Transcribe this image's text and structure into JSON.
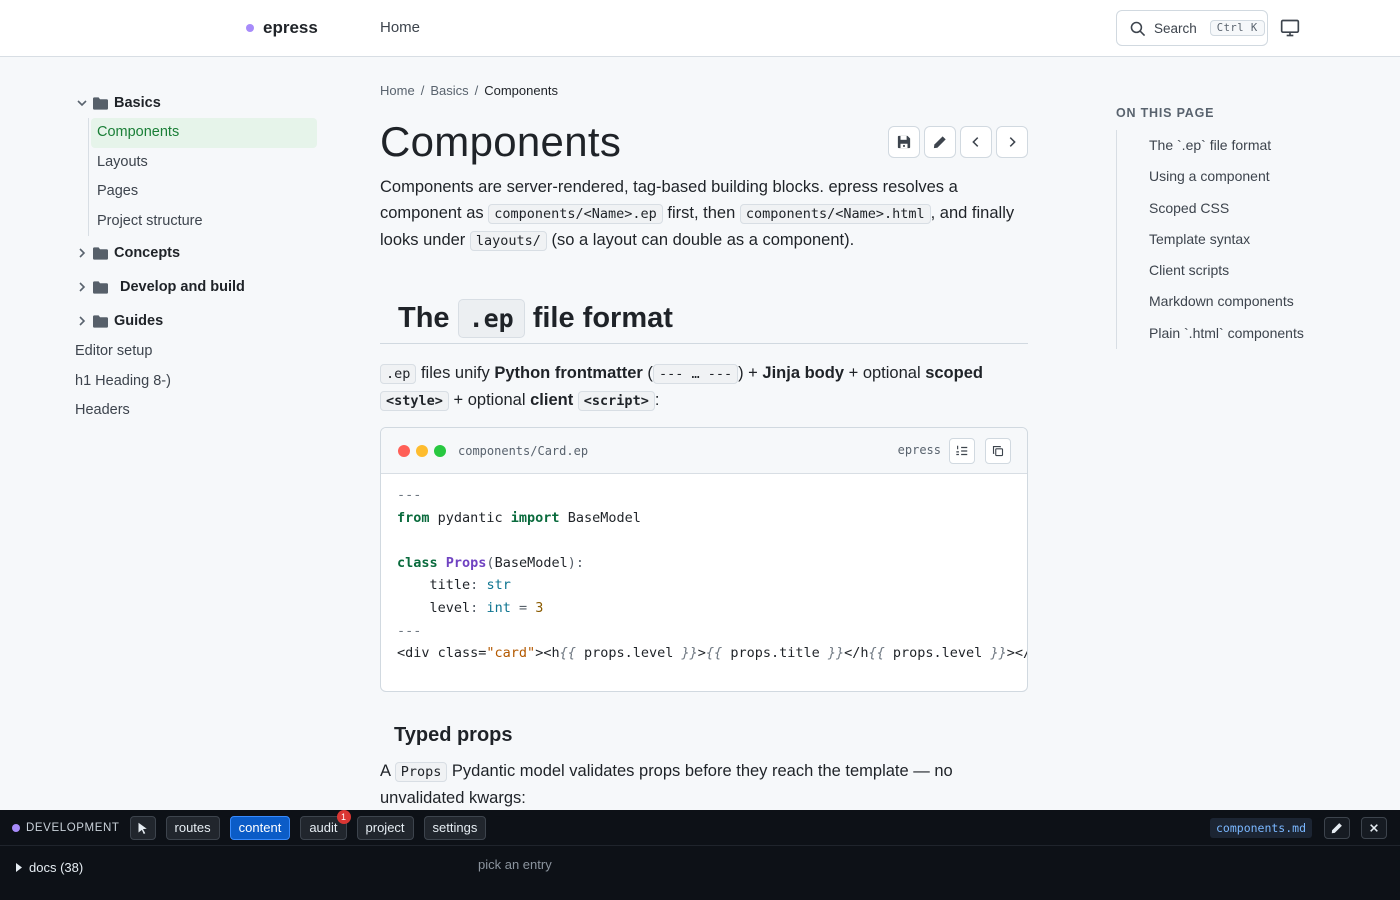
{
  "header": {
    "brand": "epress",
    "nav_home": "Home",
    "search_label": "Search",
    "search_kbd": "Ctrl K"
  },
  "sidebar": {
    "groups": [
      {
        "label": "Basics",
        "expanded": true,
        "items": [
          "Components",
          "Layouts",
          "Pages",
          "Project structure"
        ],
        "active": "Components"
      },
      {
        "label": "Concepts",
        "expanded": false
      },
      {
        "label": "Develop and build",
        "expanded": false
      },
      {
        "label": "Guides",
        "expanded": false
      }
    ],
    "plain_items": [
      "Editor setup",
      "h1 Heading 8-)",
      "Headers"
    ]
  },
  "breadcrumb": {
    "home": "Home",
    "section": "Basics",
    "current": "Components"
  },
  "page": {
    "title": "Components",
    "intro": {
      "t1": "Components are server-rendered, tag-based building blocks. epress resolves a component as ",
      "c1": "components/<Name>.ep",
      "t2": " first, then ",
      "c2": "components/<Name>.html",
      "t3": ", and finally looks under ",
      "c3": "layouts/",
      "t4": " (so a layout can double as a component)."
    },
    "h2": {
      "pre": "The",
      "code": ".ep",
      "post": "file format"
    },
    "para2": {
      "c1": ".ep",
      "t1": " files unify ",
      "b1": "Python frontmatter",
      "t2": " (",
      "c2": "--- … ---",
      "t3": ") + ",
      "b2": "Jinja body",
      "t4": " + optional ",
      "b3": "scoped",
      "c3": "<style>",
      "t5": " + optional ",
      "b4": "client",
      "c4": "<script>",
      "t6": ":"
    },
    "code": {
      "filename": "components/Card.ep",
      "lang": "epress",
      "traffic_colors": [
        "#ff5f57",
        "#febc2e",
        "#28c840"
      ]
    },
    "h3": "Typed props",
    "para3": {
      "t1": "A ",
      "c1": "Props",
      "t2": " Pydantic model validates props before they reach the template — no unvalidated kwargs:"
    }
  },
  "toc": {
    "title": "ON THIS PAGE",
    "items": [
      "The `.ep` file format",
      "Using a component",
      "Scoped CSS",
      "Template syntax",
      "Client scripts",
      "Markdown components",
      "Plain `.html` components"
    ]
  },
  "devbar": {
    "env": "DEVELOPMENT",
    "tabs": [
      "routes",
      "content",
      "audit",
      "project",
      "settings"
    ],
    "active_tab": "content",
    "audit_badge": "1",
    "file": "components.md",
    "tree_root": "docs (38)",
    "placeholder": "pick an entry"
  },
  "colors": {
    "accent": "#1a7f37",
    "brand_dot": "#a78bfa",
    "active_tab": "#0b5cc7"
  }
}
